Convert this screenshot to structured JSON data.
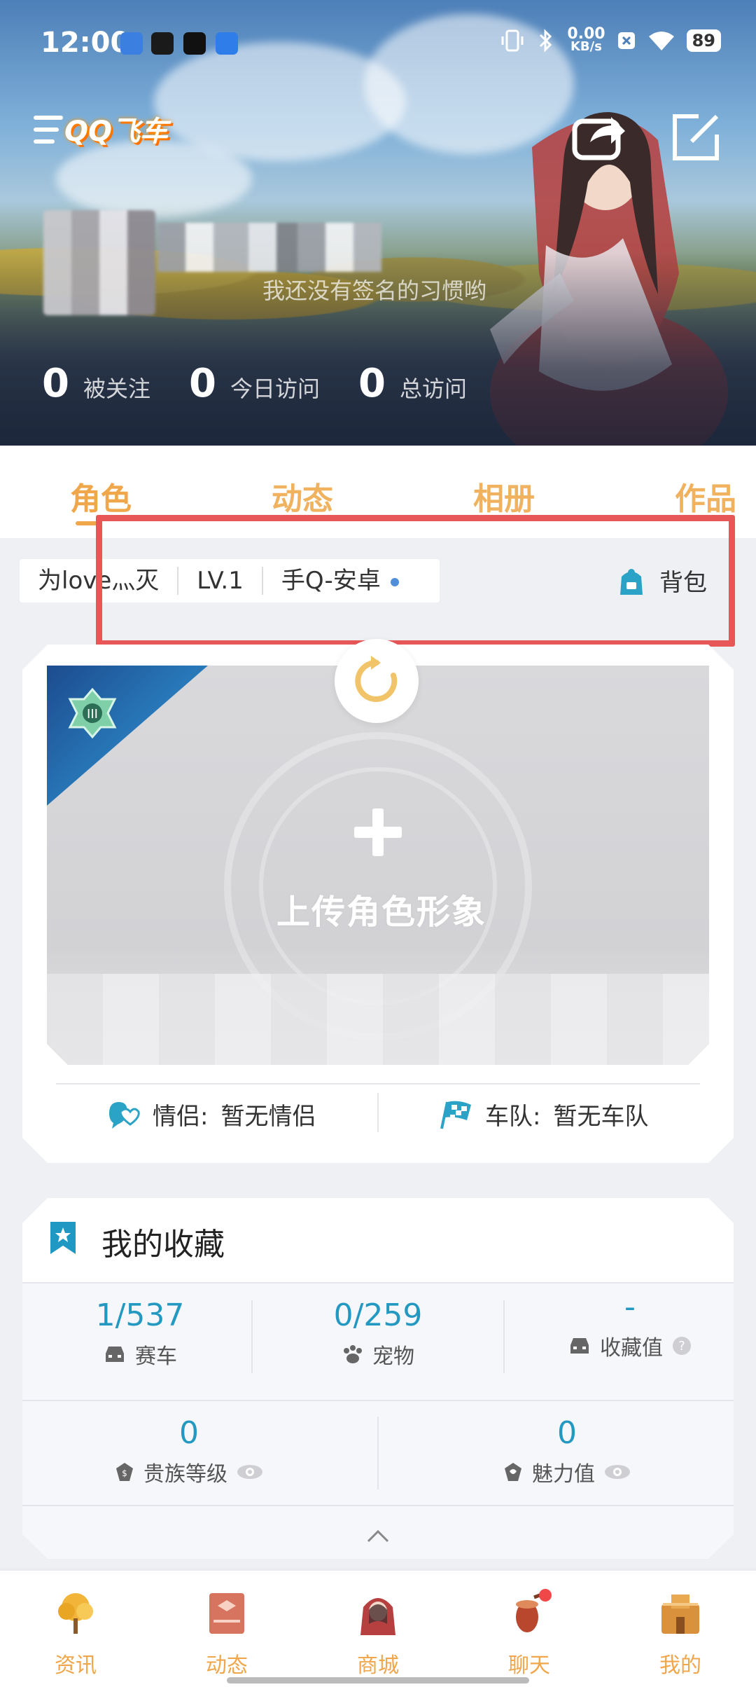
{
  "status_bar": {
    "time": "12:00",
    "net_speed_value": "0.00",
    "net_speed_unit": "KB/s",
    "battery": "89"
  },
  "header": {
    "logo_text": "QQ飞车",
    "signature": "我还没有签名的习惯哟",
    "stats": [
      {
        "value": "0",
        "label": "被关注"
      },
      {
        "value": "0",
        "label": "今日访问"
      },
      {
        "value": "0",
        "label": "总访问"
      }
    ]
  },
  "tabs": [
    {
      "label": "角色"
    },
    {
      "label": "动态"
    },
    {
      "label": "相册"
    },
    {
      "label": "作品"
    }
  ],
  "info": {
    "nickname": "为love灬灭",
    "level": "LV.1",
    "platform": "手Q-安卓",
    "backpack_label": "背包"
  },
  "character": {
    "upload_label": "上传角色形象",
    "couple_label": "情侣:",
    "couple_value": "暂无情侣",
    "team_label": "车队:",
    "team_value": "暂无车队"
  },
  "collection": {
    "title": "我的收藏",
    "row1": [
      {
        "value": "1/537",
        "label": "赛车"
      },
      {
        "value": "0/259",
        "label": "宠物"
      },
      {
        "value": "-",
        "label": "收藏值"
      }
    ],
    "row2": [
      {
        "value": "0",
        "label": "贵族等级"
      },
      {
        "value": "0",
        "label": "魅力值"
      }
    ]
  },
  "bottom_nav": [
    {
      "label": "资讯"
    },
    {
      "label": "动态"
    },
    {
      "label": "商城"
    },
    {
      "label": "聊天"
    },
    {
      "label": "我的"
    }
  ],
  "colors": {
    "accent": "#f0a64a",
    "teal": "#2398c0",
    "highlight_box": "#e85757"
  }
}
